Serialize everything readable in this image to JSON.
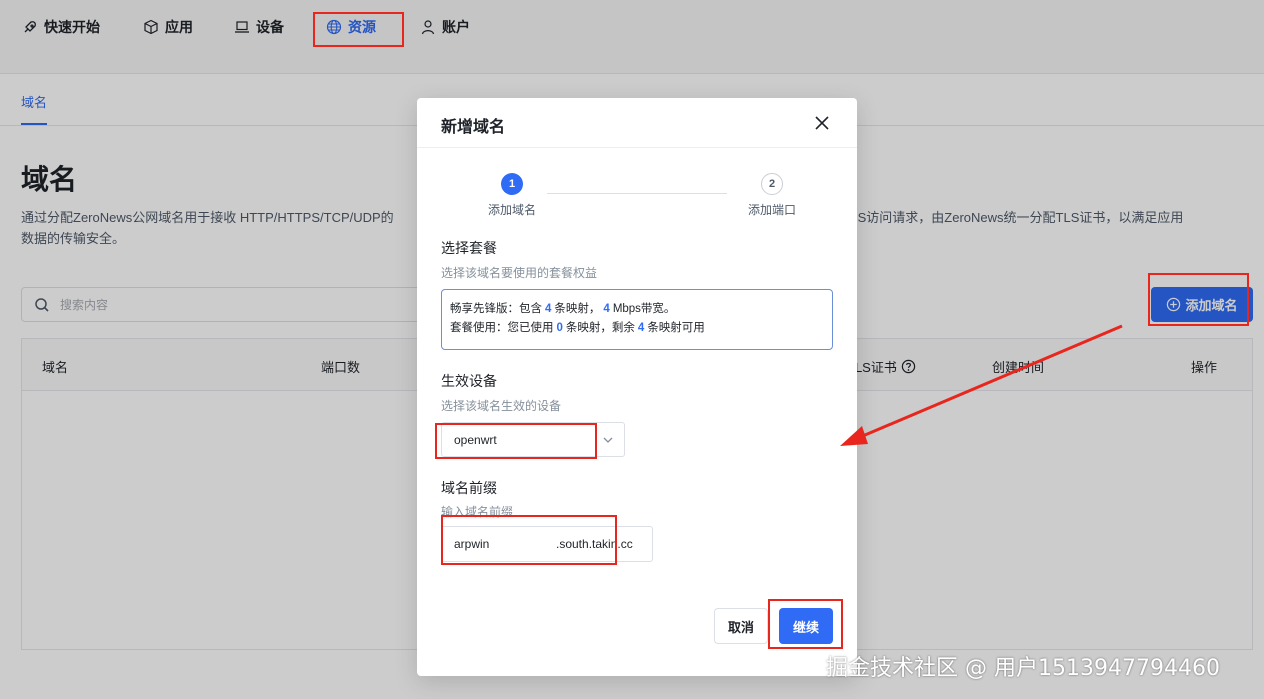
{
  "nav": {
    "items": [
      {
        "label": "快速开始",
        "icon": "rocket-icon"
      },
      {
        "label": "应用",
        "icon": "cube-icon"
      },
      {
        "label": "设备",
        "icon": "laptop-icon"
      },
      {
        "label": "资源",
        "icon": "globe-icon",
        "active": true
      },
      {
        "label": "账户",
        "icon": "user-icon"
      }
    ]
  },
  "subtab": {
    "label": "域名"
  },
  "page": {
    "title": "域名",
    "description": "通过分配ZeroNews公网域名用于接收 HTTP/HTTPS/TCP/UDP的 HTTPS访问请求，由ZeroNews统一分配TLS证书，以满足应用数据的传输安全。",
    "description_left": "通过分配ZeroNews公网域名用于接收 HTTP/HTTPS/TCP/UDP的",
    "description_right": "HTTPS访问请求，由ZeroNews统一分配TLS证书，以满足应用",
    "description_line2": "数据的传输安全。",
    "search_placeholder": "搜索内容",
    "add_button": "添加域名"
  },
  "table": {
    "columns": [
      "域名",
      "端口数",
      "TLS证书",
      "创建时间",
      "操作"
    ]
  },
  "modal": {
    "title": "新增域名",
    "steps": [
      {
        "num": "1",
        "label": "添加域名"
      },
      {
        "num": "2",
        "label": "添加端口"
      }
    ],
    "plan": {
      "title": "选择套餐",
      "subtitle": "选择该域名要使用的套餐权益",
      "line1_a": "畅享先锋版：包含",
      "line1_n1": "4",
      "line1_b": "条映射，",
      "line1_n2": "4",
      "line1_c": "Mbps带宽。",
      "line2_a": "套餐使用：您已使用",
      "line2_n1": "0",
      "line2_b": "条映射，剩余",
      "line2_n2": "4",
      "line2_c": "条映射可用"
    },
    "device": {
      "title": "生效设备",
      "subtitle": "选择该域名生效的设备",
      "selected": "openwrt"
    },
    "prefix": {
      "title": "域名前缀",
      "subtitle": "输入域名前缀",
      "value": "arpwin",
      "suffix": ".south.takin.cc"
    },
    "cancel": "取消",
    "continue": "继续"
  },
  "watermark": "掘金技术社区 @ 用户1513947794460",
  "colors": {
    "accent": "#2f6bf4",
    "annotation": "#e8261d"
  }
}
